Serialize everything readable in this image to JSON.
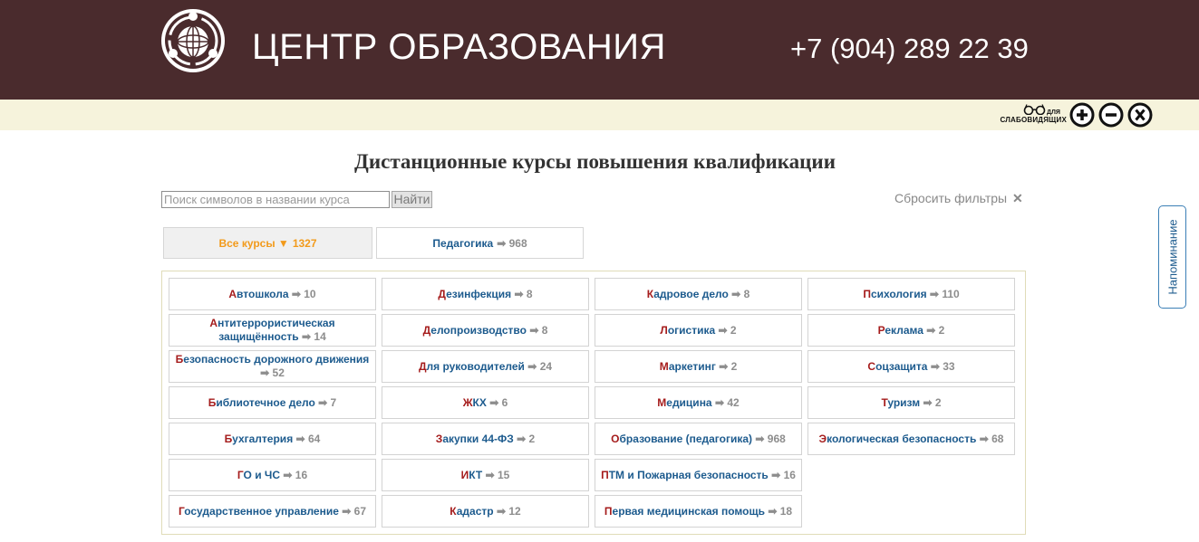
{
  "header": {
    "title": "ЦЕНТР ОБРАЗОВАНИЯ",
    "phone": "+7 (904) 289 22 39"
  },
  "accessibility": {
    "label_small": "ДЛЯ",
    "label_main": "СЛАБОВИДЯЩИХ"
  },
  "page": {
    "heading": "Дистанционные курсы повышения квалификации"
  },
  "search": {
    "placeholder": "Поиск символов в названии курса",
    "button_label": "Найти"
  },
  "reset_label": "Сбросить фильтры",
  "top_tabs": [
    {
      "label": "Все курсы ▼",
      "count": "1327"
    },
    {
      "label": "Педагогика",
      "count": "968"
    }
  ],
  "arrow": "➡",
  "categories": [
    [
      {
        "first": "А",
        "rest": "втошкола",
        "count": "10"
      },
      {
        "first": "А",
        "rest": "нтитеррористическая защищённость",
        "count": "14"
      },
      {
        "first": "Б",
        "rest": "езопасность дорожного движения",
        "count": "52"
      },
      {
        "first": "Б",
        "rest": "иблиотечное дело",
        "count": "7"
      },
      {
        "first": "Б",
        "rest": "ухгалтерия",
        "count": "64"
      },
      {
        "first": "Г",
        "rest": "О и ЧС",
        "count": "16"
      },
      {
        "first": "Г",
        "rest": "осударственное управление",
        "count": "67"
      }
    ],
    [
      {
        "first": "Д",
        "rest": "езинфекция",
        "count": "8"
      },
      {
        "first": "Д",
        "rest": "елопроизводство",
        "count": "8"
      },
      {
        "first": "Д",
        "rest": "ля руководителей",
        "count": "24"
      },
      {
        "first": "Ж",
        "rest": "КХ",
        "count": "6"
      },
      {
        "first": "З",
        "rest": "акупки 44-ФЗ",
        "count": "2"
      },
      {
        "first": "И",
        "rest": "КТ",
        "count": "15"
      },
      {
        "first": "К",
        "rest": "адастр",
        "count": "12"
      }
    ],
    [
      {
        "first": "К",
        "rest": "адровое дело",
        "count": "8"
      },
      {
        "first": "Л",
        "rest": "огистика",
        "count": "2"
      },
      {
        "first": "М",
        "rest": "аркетинг",
        "count": "2"
      },
      {
        "first": "М",
        "rest": "едицина",
        "count": "42"
      },
      {
        "first": "О",
        "rest": "бразование (педагогика)",
        "count": "968"
      },
      {
        "first": "П",
        "rest": "ТМ и Пожарная безопасность",
        "count": "16"
      },
      {
        "first": "П",
        "rest": "ервая медицинская помощь",
        "count": "18"
      }
    ],
    [
      {
        "first": "П",
        "rest": "сихология",
        "count": "110"
      },
      {
        "first": "Р",
        "rest": "еклама",
        "count": "2"
      },
      {
        "first": "С",
        "rest": "оцзащита",
        "count": "33"
      },
      {
        "first": "Т",
        "rest": "уризм",
        "count": "2"
      },
      {
        "first": "Э",
        "rest": "кологическая безопасность",
        "count": "68"
      }
    ]
  ],
  "reminder_label": "Напоминание",
  "colors": {
    "header_bg": "#4a2b2d",
    "access_bar_bg": "#f6f3dc",
    "link_blue": "#1d5b8e",
    "first_letter_red": "#a51c1c",
    "active_orange": "#f29a1a",
    "count_gray": "#8d8d8d"
  },
  "icons": {
    "logo": "globe-logo-icon",
    "glasses": "glasses-icon",
    "zoom_in": "plus-circle-icon",
    "zoom_out": "minus-circle-icon",
    "close": "x-circle-icon"
  }
}
